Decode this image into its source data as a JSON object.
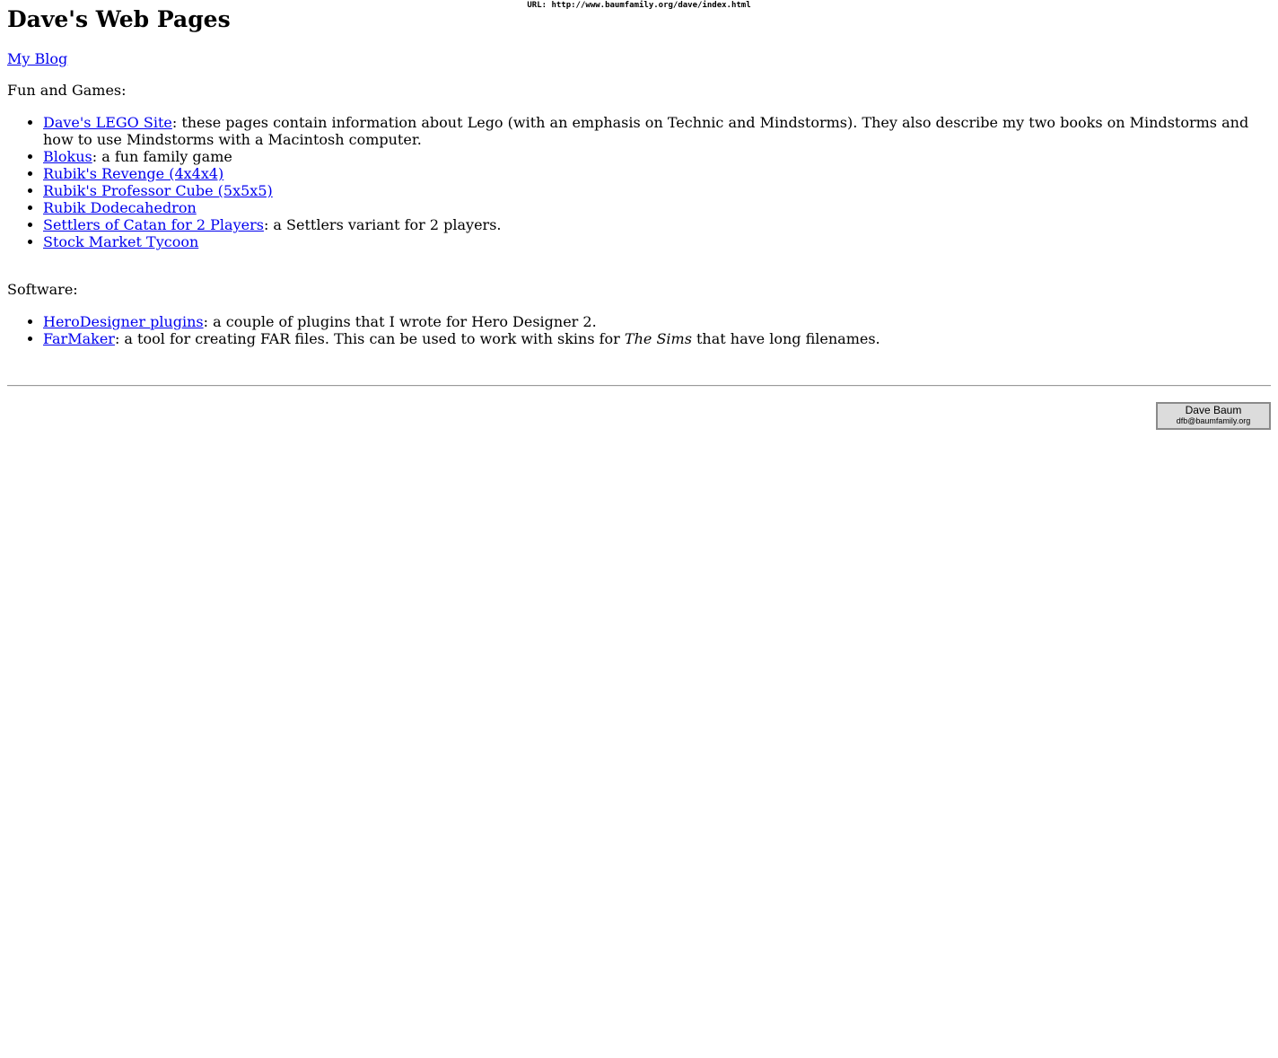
{
  "banner": {
    "url_label": "URL: http://www.baumfamily.org/dave/index.html"
  },
  "header": {
    "title": "Dave's Web Pages"
  },
  "blog": {
    "label": "My Blog"
  },
  "fun_section": {
    "heading": "Fun and Games:",
    "items": [
      {
        "link": "Dave's LEGO Site",
        "desc": ": these pages contain information about Lego (with an emphasis on Technic and Mindstorms). They also describe my two books on Mindstorms and how to use Mindstorms with a Macintosh computer."
      },
      {
        "link": "Blokus",
        "desc": ": a fun family game"
      },
      {
        "link": "Rubik's Revenge (4x4x4)",
        "desc": ""
      },
      {
        "link": "Rubik's Professor Cube (5x5x5)",
        "desc": ""
      },
      {
        "link": "Rubik Dodecahedron",
        "desc": ""
      },
      {
        "link": "Settlers of Catan for 2 Players",
        "desc": ": a Settlers variant for 2 players."
      },
      {
        "link": "Stock Market Tycoon",
        "desc": ""
      }
    ]
  },
  "software_section": {
    "heading": "Software:",
    "items": [
      {
        "link": "HeroDesigner plugins",
        "desc": ": a couple of plugins that I wrote for Hero Designer 2."
      },
      {
        "link": "FarMaker",
        "desc_before": ": a tool for creating FAR files. This can be used to work with skins for ",
        "desc_italic": "The Sims",
        "desc_after": " that have long filenames."
      }
    ]
  },
  "signature": {
    "name": "Dave Baum",
    "email": "dfb@baumfamily.org"
  },
  "colors": {
    "link": "#0000ee",
    "signature_bg": "#dcdcdc"
  }
}
